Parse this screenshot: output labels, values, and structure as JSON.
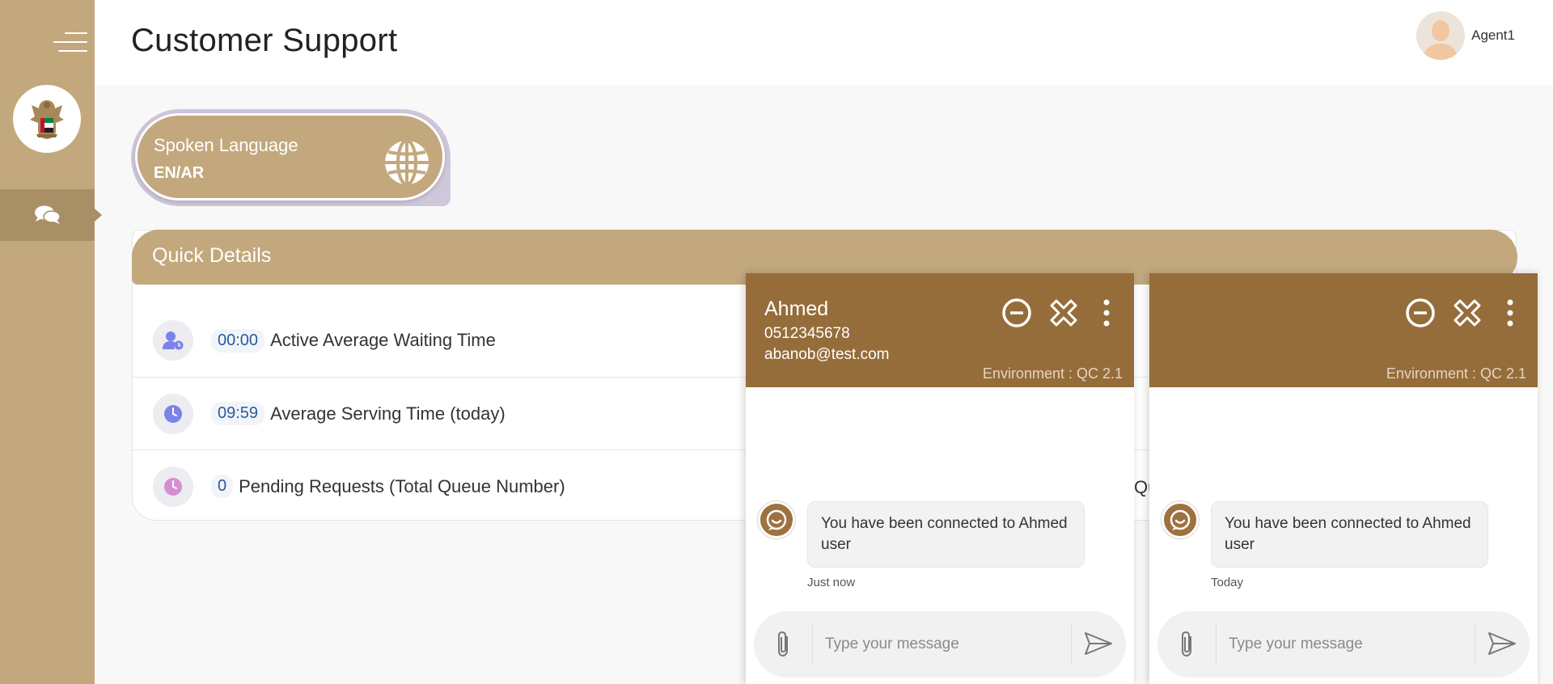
{
  "header": {
    "title": "Customer Support",
    "user_name": "Agent1"
  },
  "sidebar": {
    "icons": [
      "menu-icon",
      "emblem-logo",
      "chat-icon"
    ],
    "color": "#c3a87d",
    "active_color": "#a88f65"
  },
  "language_card": {
    "label": "Spoken Language",
    "value": "EN/AR",
    "icon": "globe-icon"
  },
  "quick_details": {
    "title": "Quick Details",
    "rows": [
      {
        "value": "00:00",
        "label": "Active Average Waiting Time",
        "icon": "user-clock-icon",
        "icon_color": "#7b83ea"
      },
      {
        "value": "09:59",
        "label": "Average Serving Time (today)",
        "icon": "clock-icon",
        "icon_color": "#7b83ea"
      },
      {
        "value": "0",
        "label": "Pending Requests (Total Queue Number)",
        "icon": "clock-icon",
        "icon_color": "#d48fd4"
      }
    ],
    "hidden_text": "Qu"
  },
  "chats": [
    {
      "name": "Ahmed",
      "phone": "0512345678",
      "email": "abanob@test.com",
      "environment": "Environment : QC 2.1",
      "message": "You have been connected to Ahmed user",
      "time": "Just now",
      "placeholder": "Type your message"
    },
    {
      "name": "",
      "phone": "",
      "email": "",
      "environment": "Environment : QC 2.1",
      "message": "You have been connected to Ahmed user",
      "time": "Today",
      "placeholder": "Type your message"
    }
  ],
  "colors": {
    "chat_header": "#956d3b",
    "accent": "#c3a87d",
    "value_text": "#2b5a9e"
  }
}
